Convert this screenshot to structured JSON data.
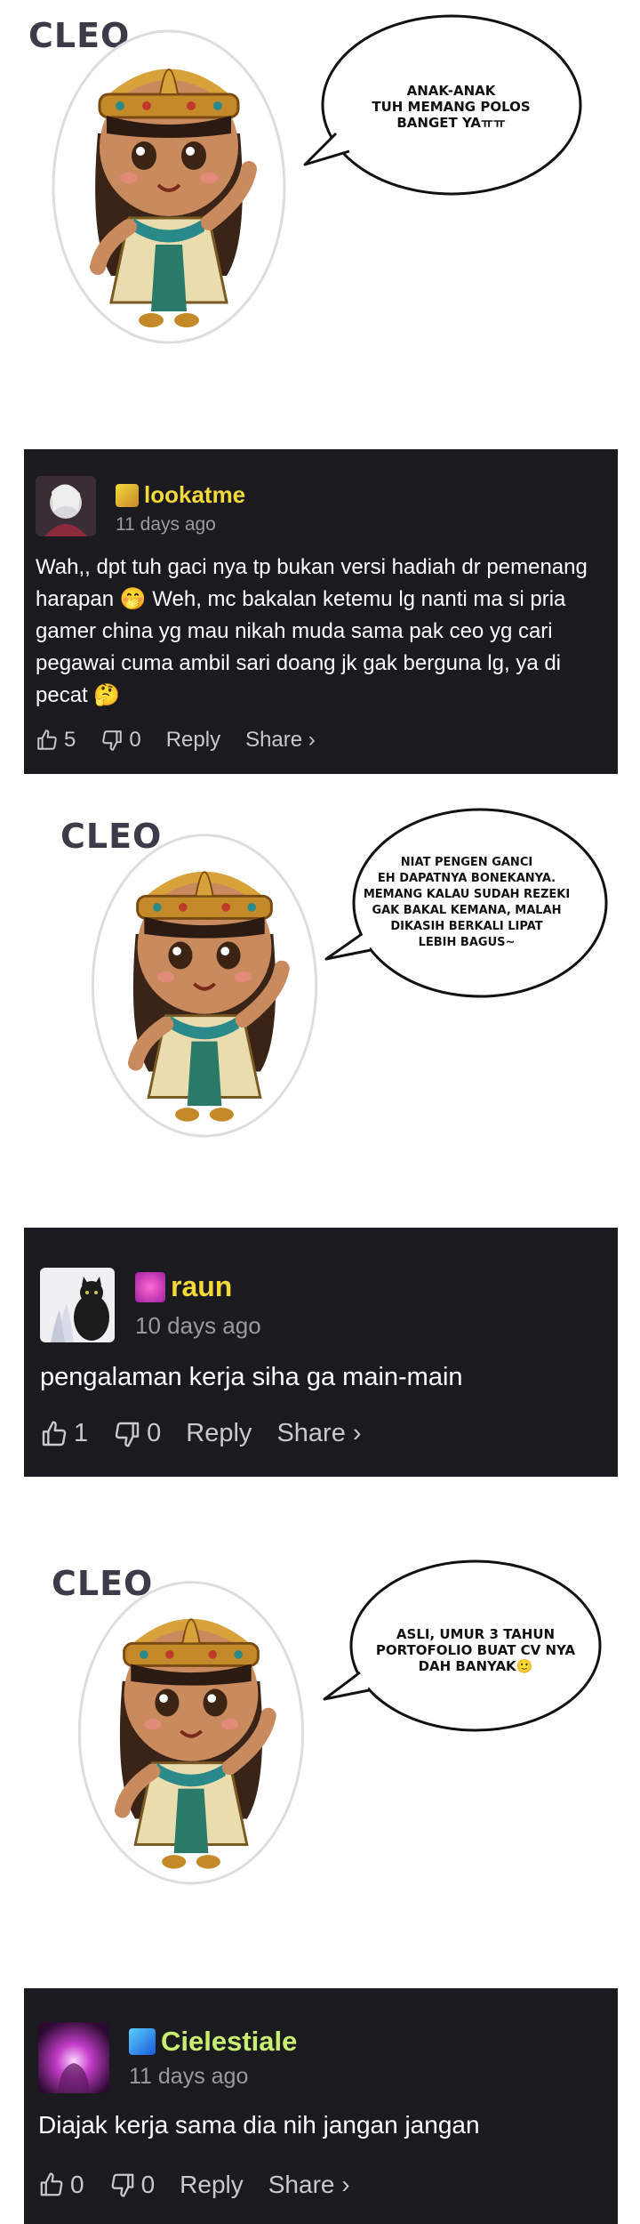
{
  "panels": [
    {
      "label": "CLEO",
      "bubble": "ANAK-ANAK\nTUH MEMANG POLOS\nBANGET YAㅠㅠ"
    },
    {
      "label": "CLEO",
      "bubble": "NIAT PENGEN GANCI\nEH DAPATNYA BONEKANYA.\nMEMANG KALAU SUDAH REZEKI\nGAK BAKAL KEMANA, MALAH\nDIKASIH BERKALI LIPAT\nLEBIH BAGUS~"
    },
    {
      "label": "CLEO",
      "bubble": "ASLI, UMUR 3 TAHUN\nPORTOFOLIO BUAT CV NYA\nDAH BANYAK🙂"
    }
  ],
  "comments": [
    {
      "username": "lookatme",
      "timestamp": "11 days ago",
      "text": "Wah,, dpt tuh gaci nya tp bukan versi hadiah dr pemenang harapan 🤭 Weh, mc bakalan ketemu lg nanti ma si pria gamer china yg mau nikah muda sama pak ceo yg cari pegawai cuma ambil sari doang jk gak berguna lg, ya di pecat 🤔",
      "likes": "5",
      "dislikes": "0",
      "reply_label": "Reply",
      "share_label": "Share ›"
    },
    {
      "username": "raun",
      "timestamp": "10 days ago",
      "text": "pengalaman kerja siha ga main-main",
      "likes": "1",
      "dislikes": "0",
      "reply_label": "Reply",
      "share_label": "Share ›"
    },
    {
      "username": "Cielestiale",
      "timestamp": "11 days ago",
      "text": "Diajak kerja sama dia nih jangan jangan",
      "likes": "0",
      "dislikes": "0",
      "reply_label": "Reply",
      "share_label": "Share ›"
    }
  ],
  "colors": {
    "card_bg": "#1a1a1f",
    "username": "#f5d83a",
    "timestamp": "#9a9aa4"
  }
}
